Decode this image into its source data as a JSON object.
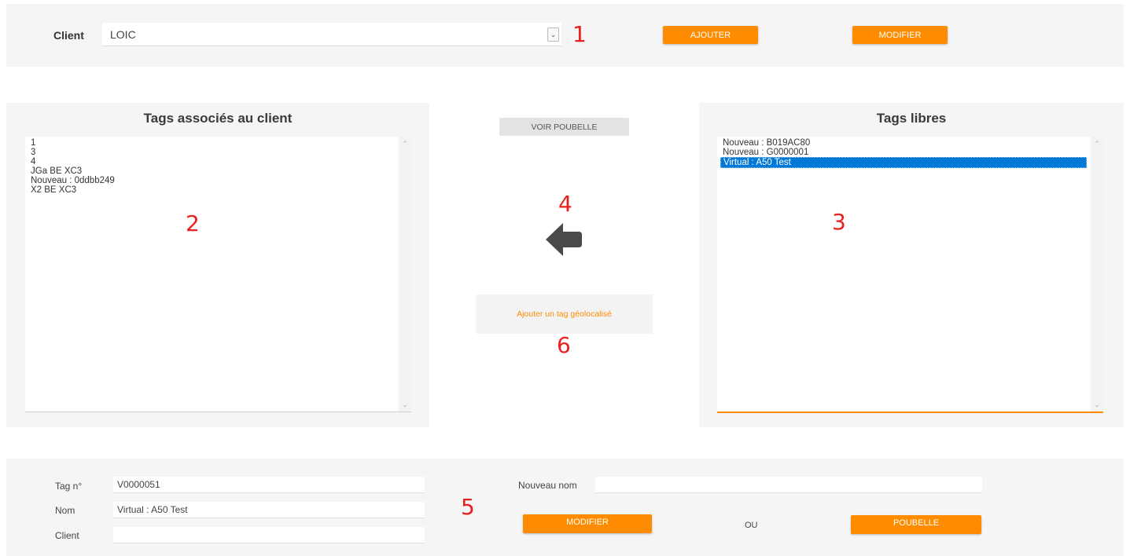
{
  "client_bar": {
    "label": "Client",
    "selected": "LOIC",
    "add_label": "AJOUTER",
    "modify_label": "MODIFIER",
    "annotation": "1"
  },
  "assoc_panel": {
    "title": "Tags associés au client",
    "items": [
      "1",
      "3",
      "4",
      "JGa BE XC3",
      "Nouveau : 0ddbb249",
      "X2 BE XC3"
    ],
    "annotation": "2"
  },
  "middle": {
    "trash_label": "VOIR POUBELLE",
    "arrow_annotation": "4",
    "arrow_icon": "arrow-left-icon",
    "add_geo_label": "Ajouter un tag géolocalisé",
    "geo_annotation": "6"
  },
  "free_panel": {
    "title": "Tags libres",
    "items": [
      "Nouveau : B019AC80",
      "Nouveau : G0000001",
      "Virtual : A50 Test"
    ],
    "selected_index": 2,
    "annotation": "3"
  },
  "details": {
    "tag_label": "Tag n°",
    "tag_value": "V0000051",
    "name_label": "Nom",
    "name_value": "Virtual : A50 Test",
    "client_label": "Client",
    "client_value": "",
    "new_name_label": "Nouveau nom",
    "new_name_value": "",
    "modify_label": "MODIFIER",
    "or_label": "OU",
    "trash_label": "POUBELLE",
    "annotation": "5"
  },
  "colors": {
    "accent": "#ff8c00",
    "selection": "#0078d7",
    "annotation": "#e8201e",
    "panel_bg": "#f5f5f5"
  }
}
